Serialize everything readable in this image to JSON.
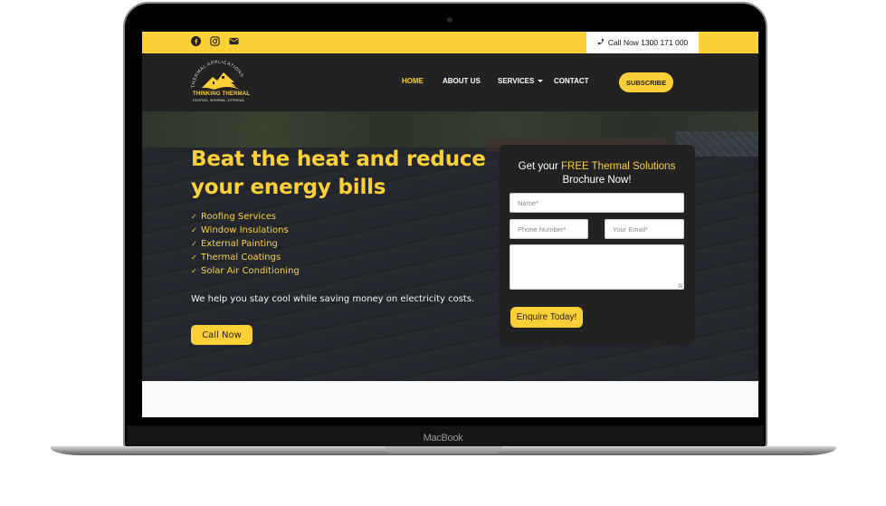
{
  "device": {
    "brand_label": "MacBook"
  },
  "topbar": {
    "social_icons": [
      "facebook-icon",
      "instagram-icon",
      "envelope-icon"
    ],
    "call_label": "Call Now 1300 171 000",
    "call_icon": "phone-icon"
  },
  "logo": {
    "arc_text": "THERMAL APPLICATIONS",
    "title": "THINKING THERMAL",
    "subtitle": "ROOFING, INTERNAL, EXTERNAL"
  },
  "nav": {
    "items": [
      {
        "label": "HOME",
        "active": true
      },
      {
        "label": "ABOUT US",
        "active": false
      },
      {
        "label": "SERVICES",
        "active": false,
        "has_dropdown": true
      },
      {
        "label": "CONTACT",
        "active": false
      }
    ],
    "subscribe_label": "SUBSCRIBE"
  },
  "hero": {
    "headline": "Beat the heat and reduce your energy bills",
    "services": [
      "Roofing Services",
      "Window Insulations",
      "External Painting",
      "Thermal Coatings",
      "Solar Air Conditioning"
    ],
    "check_icon": "✓",
    "tagline": "We help you stay cool while saving money on electricity costs.",
    "cta_label": "Call Now"
  },
  "form": {
    "title_prefix": "Get your ",
    "title_highlight": "FREE Thermal Solutions",
    "title_suffix": "Brochure Now!",
    "name_placeholder": "Name*",
    "phone_placeholder": "Phone Number*",
    "email_placeholder": "Your Email*",
    "message_placeholder": "",
    "submit_label": "Enquire Today!"
  },
  "colors": {
    "accent": "#fdd037",
    "dark": "#222222"
  }
}
